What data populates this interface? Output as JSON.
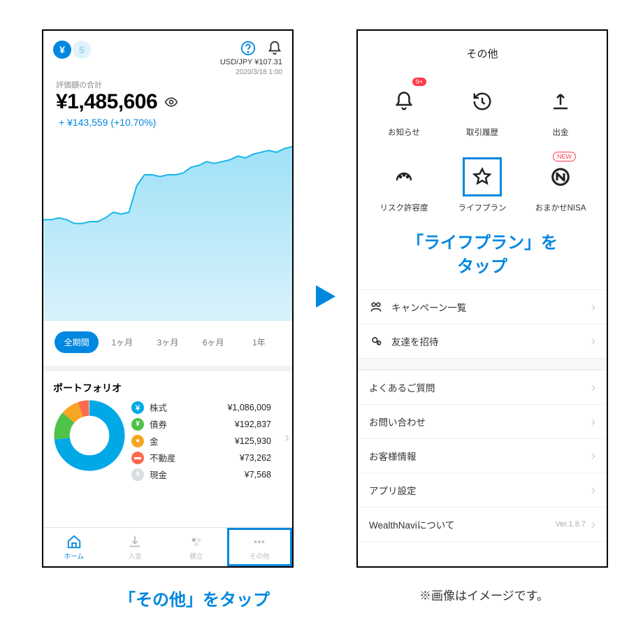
{
  "left": {
    "summary_label": "評価額の合計",
    "amount": "¥1,485,606",
    "gain": "+ ¥143,559  (+10.70%)",
    "rate": "USD/JPY  ¥107.31",
    "rate_ts": "2020/3/18 1:00",
    "periods": [
      "全期間",
      "1ヶ月",
      "3ヶ月",
      "6ヶ月",
      "1年"
    ],
    "portfolio_title": "ポートフォリオ",
    "portfolio": [
      {
        "label": "株式",
        "value": "¥1,086,009",
        "color": "#00a9e6",
        "glyph": "￥"
      },
      {
        "label": "債券",
        "value": "¥192,837",
        "color": "#4fc24a",
        "glyph": "¥"
      },
      {
        "label": "金",
        "value": "¥125,930",
        "color": "#f6a623",
        "glyph": "●"
      },
      {
        "label": "不動産",
        "value": "¥73,262",
        "color": "#ff6a4d",
        "glyph": "▬"
      },
      {
        "label": "現金",
        "value": "¥7,568",
        "color": "#d7dde1",
        "glyph": "¥"
      }
    ],
    "tabs": [
      {
        "label": "ホーム"
      },
      {
        "label": "入金"
      },
      {
        "label": "積立"
      },
      {
        "label": "その他"
      }
    ]
  },
  "right": {
    "title": "その他",
    "grid": [
      {
        "label": "お知らせ",
        "badge": "9+"
      },
      {
        "label": "取引履歴"
      },
      {
        "label": "出金"
      },
      {
        "label": "リスク許容度"
      },
      {
        "label": "ライフプラン",
        "boxed": true
      },
      {
        "label": "おまかせNISA",
        "new": "NEW"
      }
    ],
    "instruction": "「ライフプラン」を\nタップ",
    "rows_top": [
      {
        "label": "キャンペーン一覧",
        "icon": true
      },
      {
        "label": "友達を招待",
        "icon": true
      }
    ],
    "rows_bottom": [
      {
        "label": "よくあるご質問"
      },
      {
        "label": "お問い合わせ"
      },
      {
        "label": "お客様情報"
      },
      {
        "label": "アプリ設定"
      },
      {
        "label": "WealthNaviについて",
        "ver": "Ver.1.8.7"
      }
    ]
  },
  "arrow_caption_left": "「その他」をタップ",
  "arrow_caption_right": "※画像はイメージです。",
  "chart_data": {
    "type": "area",
    "title": "",
    "series": [
      {
        "name": "評価額",
        "values": [
          54,
          54,
          55,
          54,
          52,
          52,
          53,
          53,
          55,
          58,
          57,
          58,
          72,
          78,
          78,
          77,
          78,
          78,
          79,
          82,
          83,
          85,
          84,
          85,
          86,
          88,
          87,
          89,
          90,
          91,
          90,
          92,
          93
        ]
      }
    ],
    "x": [
      0,
      1,
      2,
      3,
      4,
      5,
      6,
      7,
      8,
      9,
      10,
      11,
      12,
      13,
      14,
      15,
      16,
      17,
      18,
      19,
      20,
      21,
      22,
      23,
      24,
      25,
      26,
      27,
      28,
      29,
      30,
      31,
      32
    ],
    "ylim": [
      0,
      100
    ]
  },
  "donut_data": {
    "type": "pie",
    "slices": [
      {
        "name": "株式",
        "value": 1086009,
        "color": "#00a9e6"
      },
      {
        "name": "債券",
        "value": 192837,
        "color": "#4fc24a"
      },
      {
        "name": "金",
        "value": 125930,
        "color": "#f6a623"
      },
      {
        "name": "不動産",
        "value": 73262,
        "color": "#ff6a4d"
      },
      {
        "name": "現金",
        "value": 7568,
        "color": "#d7dde1"
      }
    ]
  }
}
